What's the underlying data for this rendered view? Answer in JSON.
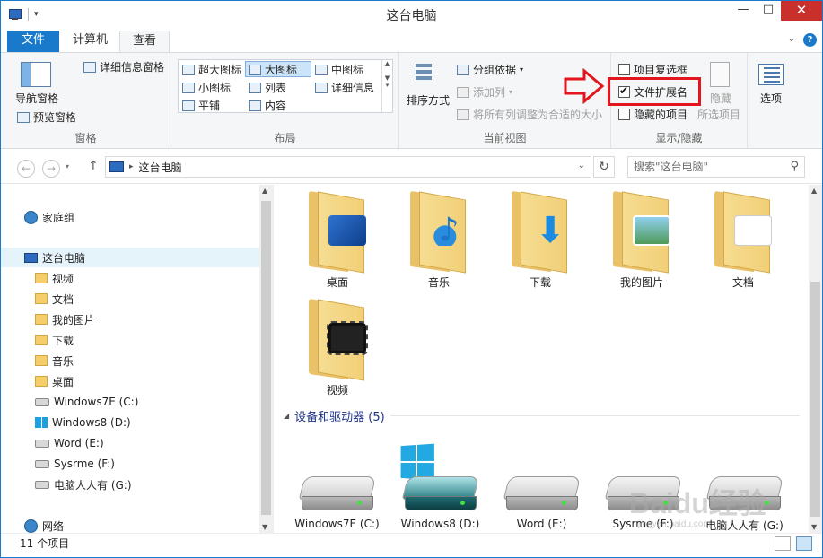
{
  "window": {
    "title": "这台电脑",
    "buttons": {
      "minimize": "—",
      "maximize": "□",
      "close": "✕"
    }
  },
  "tabs": {
    "file": "文件",
    "computer": "计算机",
    "view": "查看",
    "help": "?"
  },
  "ribbon": {
    "panes": {
      "nav_pane": "导航窗格",
      "preview_pane": "预览窗格",
      "details_pane": "详细信息窗格",
      "label": "窗格"
    },
    "layout": {
      "extra_large": "超大图标",
      "large": "大图标",
      "medium": "中图标",
      "small": "小图标",
      "list": "列表",
      "details": "详细信息",
      "tiles": "平铺",
      "content": "内容",
      "label": "布局"
    },
    "current_view": {
      "sort": "排序方式",
      "group_by": "分组依据",
      "add_column": "添加列",
      "fit_columns": "将所有列调整为合适的大小",
      "label": "当前视图"
    },
    "show_hide": {
      "item_checkboxes": "项目复选框",
      "file_extensions": "文件扩展名",
      "hidden_items": "隐藏的项目",
      "hide": "隐藏",
      "hide_selected": "所选项目",
      "label": "显示/隐藏",
      "item_checkboxes_checked": false,
      "file_extensions_checked": true,
      "hidden_items_checked": false
    },
    "options": "选项"
  },
  "navbar": {
    "path": "这台电脑",
    "search_placeholder": "搜索\"这台电脑\""
  },
  "leftnav": {
    "homegroup": "家庭组",
    "this_pc": "这台电脑",
    "items": [
      "视频",
      "文档",
      "我的图片",
      "下载",
      "音乐",
      "桌面"
    ],
    "drives": [
      "Windows7E (C:)",
      "Windows8 (D:)",
      "Word (E:)",
      "Sysrme (F:)",
      "电脑人人有 (G:)"
    ],
    "network": "网络"
  },
  "content": {
    "folders": [
      "桌面",
      "音乐",
      "下载",
      "我的图片",
      "文档",
      "视频"
    ],
    "section_title": "设备和驱动器 (5)",
    "drives": [
      "Windows7E (C:)",
      "Windows8 (D:)",
      "Word (E:)",
      "Sysrme (F:)",
      "电脑人人有 (G:)"
    ]
  },
  "status": {
    "item_count": "11 个项目"
  },
  "watermark": {
    "main": "Baidu经验",
    "sub": "jingyan.baidu.com"
  },
  "colors": {
    "accent": "#1979ca",
    "highlight_box": "#e2161c",
    "close_button": "#c9302c"
  }
}
